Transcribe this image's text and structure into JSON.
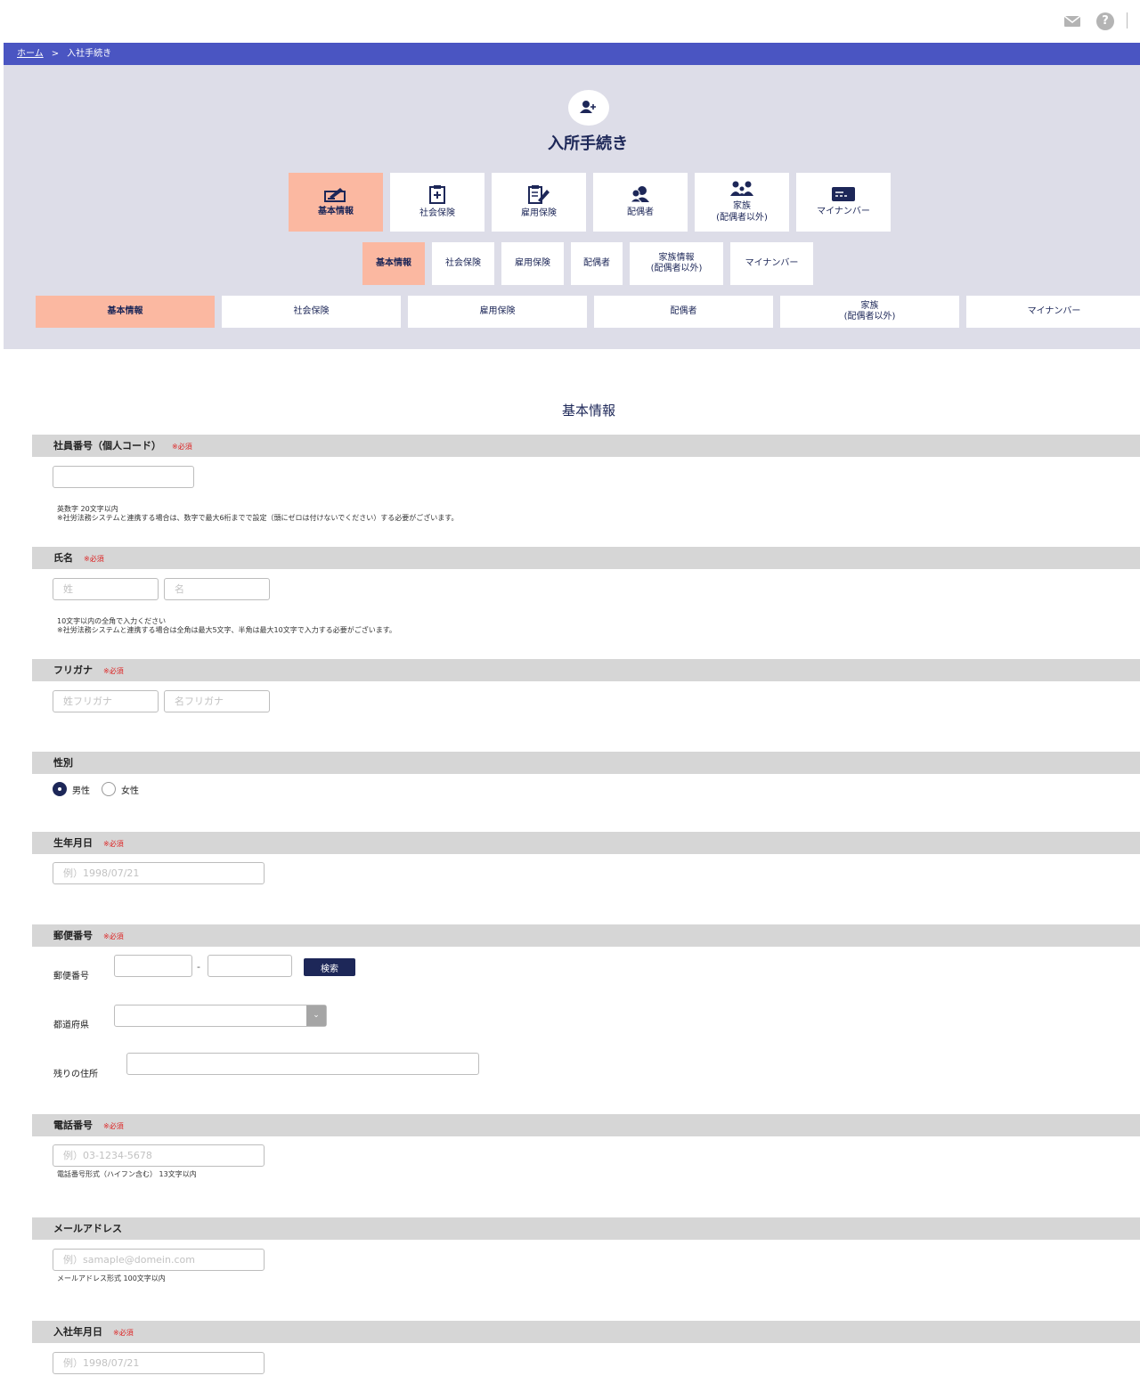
{
  "breadcrumb": {
    "home": "ホーム",
    "separator": ">",
    "current": "入社手続き"
  },
  "page_title": "入所手続き",
  "main_tabs": [
    {
      "label": "基本情報",
      "icon": "basic-info-icon",
      "active": true
    },
    {
      "label": "社会保険",
      "icon": "clipboard-plus-icon"
    },
    {
      "label": "雇用保険",
      "icon": "clipboard-pen-icon"
    },
    {
      "label": "配偶者",
      "icon": "spouse-icon"
    },
    {
      "label": "家族\n(配偶者以外)",
      "icon": "family-icon"
    },
    {
      "label": "マイナンバー",
      "icon": "id-card-icon"
    }
  ],
  "sub_tabs": [
    {
      "label": "基本情報",
      "active": true
    },
    {
      "label": "社会保険"
    },
    {
      "label": "雇用保険"
    },
    {
      "label": "配偶者"
    },
    {
      "label": "家族情報\n(配偶者以外)"
    },
    {
      "label": "マイナンバー"
    }
  ],
  "wide_tabs": [
    {
      "label": "基本情報",
      "active": true
    },
    {
      "label": "社会保険"
    },
    {
      "label": "雇用保険"
    },
    {
      "label": "配偶者"
    },
    {
      "label": "家族\n(配偶者以外)"
    },
    {
      "label": "マイナンバー"
    }
  ],
  "section_title": "基本情報",
  "required_mark": "※必須",
  "fields": {
    "employee_no": {
      "label": "社員番号（個人コード）",
      "note1": "英数字 20文字以内",
      "note2": "※社労法務システムと連携する場合は、数字で最大6桁までで設定（頭にゼロは付けないでください）する必要がございます。"
    },
    "name": {
      "label": "氏名",
      "last_placeholder": "姓",
      "first_placeholder": "名",
      "note1": "10文字以内の全角で入力ください",
      "note2": "※社労法務システムと連携する場合は全角は最大5文字、半角は最大10文字で入力する必要がございます。"
    },
    "kana": {
      "label": "フリガナ",
      "last_placeholder": "姓フリガナ",
      "first_placeholder": "名フリガナ"
    },
    "gender": {
      "label": "性別",
      "male": "男性",
      "female": "女性",
      "selected": "male"
    },
    "birthday": {
      "label": "生年月日",
      "placeholder": "例）1998/07/21"
    },
    "postal": {
      "label": "郵便番号",
      "sub_label": "郵便番号",
      "dash": "-",
      "search_button": "検索",
      "prefecture_label": "都道府県",
      "address_label": "残りの住所"
    },
    "phone": {
      "label": "電話番号",
      "placeholder": "例）03-1234-5678",
      "note": "電話番号形式（ハイフン含む） 13文字以内"
    },
    "email": {
      "label": "メールアドレス",
      "placeholder": "例）samaple@domein.com",
      "note": "メールアドレス形式 100文字以内"
    },
    "join_date": {
      "label": "入社年月日",
      "placeholder": "例）1998/07/21"
    }
  },
  "colors": {
    "primary": "#1d2758",
    "breadcrumb_bg": "#4a55c2",
    "hero_bg": "#dddde8",
    "active_tab": "#fbb8a1",
    "required": "#dd2222",
    "section_header": "#d6d6d6"
  }
}
